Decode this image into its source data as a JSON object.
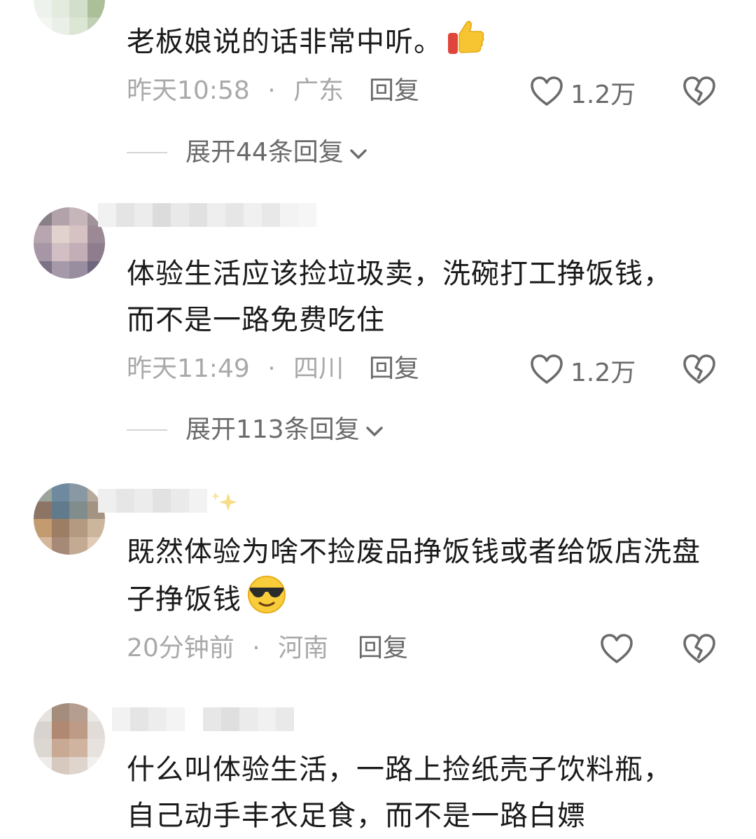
{
  "comments": [
    {
      "text": "老板娘说的话非常中听。",
      "emoji": "thumbs-up",
      "time": "昨天10:58",
      "location": "广东",
      "reply_label": "回复",
      "likes": "1.2万",
      "expand_label": "展开44条回复"
    },
    {
      "text": "体验生活应该捡垃圾卖，洗碗打工挣饭钱，而不是一路免费吃住",
      "time": "昨天11:49",
      "location": "四川",
      "reply_label": "回复",
      "likes": "1.2万",
      "expand_label": "展开113条回复"
    },
    {
      "text": "既然体验为啥不捡废品挣饭钱或者给饭店洗盘子挣饭钱",
      "emoji": "sunglasses-face",
      "time": "20分钟前",
      "location": "河南",
      "reply_label": "回复",
      "likes": ""
    },
    {
      "text": "什么叫体验生活，一路上捡纸壳子饮料瓶，自己动手丰衣足食，而不是一路白嫖"
    }
  ],
  "separator": "·",
  "colors": {
    "text": "#1a1a1a",
    "meta": "#a9a9a9",
    "action": "#6b6b6b"
  }
}
